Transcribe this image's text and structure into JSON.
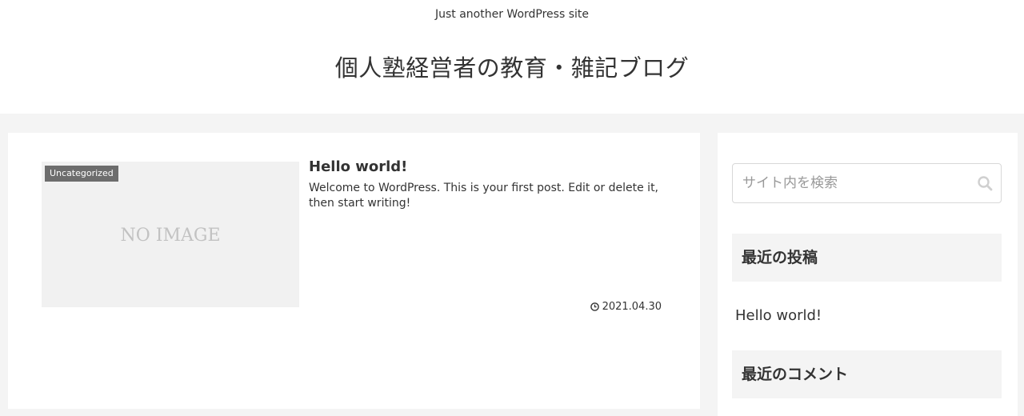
{
  "header": {
    "tagline": "Just another WordPress site",
    "site_title": "個人塾経営者の教育・雑記ブログ"
  },
  "post": {
    "category": "Uncategorized",
    "thumbnail_text": "NO IMAGE",
    "title": "Hello world!",
    "excerpt": "Welcome to WordPress. This is your first post. Edit or delete it, then start writing!",
    "date": "2021.04.30"
  },
  "sidebar": {
    "search_placeholder": "サイト内を検索",
    "recent_posts_title": "最近の投稿",
    "recent_posts": [
      "Hello world!"
    ],
    "recent_comments_title": "最近のコメント"
  },
  "icons": {
    "search": "search-icon",
    "clock": "clock-icon"
  },
  "colors": {
    "page_background": "#f4f4f4",
    "category_badge": "#6d6d6d",
    "thumbnail_background": "#f1f1f1"
  }
}
